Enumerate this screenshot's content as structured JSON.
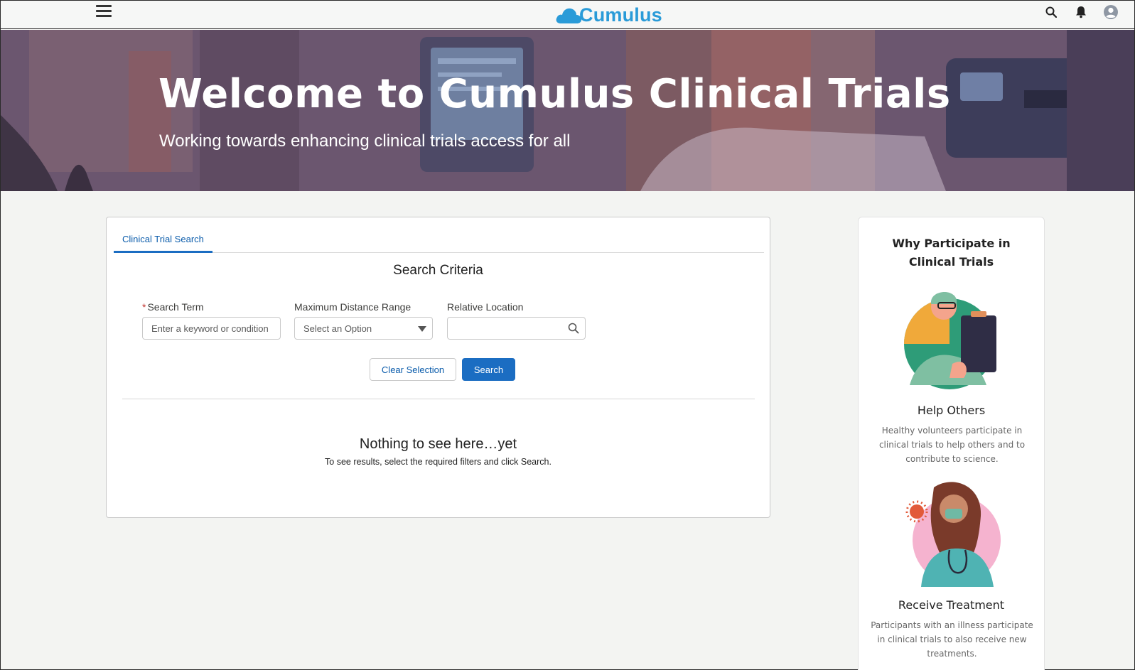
{
  "header": {
    "logo_text": "Cumulus",
    "brand_color": "#2a9bd8",
    "icons": [
      "menu-icon",
      "search-icon",
      "bell-icon",
      "user-avatar-icon"
    ]
  },
  "hero": {
    "title": "Welcome to Cumulus Clinical Trials",
    "subtitle": "Working towards enhancing clinical trials access for all"
  },
  "search_card": {
    "tab_label": "Clinical Trial Search",
    "section_title": "Search Criteria",
    "fields": {
      "search_term": {
        "label": "Search Term",
        "required_mark": "*",
        "placeholder": "Enter a keyword or condition"
      },
      "distance": {
        "label": "Maximum Distance Range",
        "value": "Select an Option"
      },
      "location": {
        "label": "Relative Location",
        "value": ""
      }
    },
    "clear_label": "Clear Selection",
    "search_label": "Search",
    "empty_title": "Nothing to see here…yet",
    "empty_subtitle": "To see results, select the required filters and click Search."
  },
  "sidebar": {
    "title_line1": "Why Participate in",
    "title_line2": "Clinical Trials",
    "items": [
      {
        "heading": "Help Others",
        "lines": [
          "Healthy volunteers participate in",
          "clinical trials to help others and to",
          "contribute to science."
        ]
      },
      {
        "heading": "Receive Treatment",
        "lines": [
          "Participants with an illness participate",
          "in clinical trials to also receive new",
          "treatments."
        ]
      }
    ]
  },
  "colors": {
    "accent": "#1b6dc2",
    "link": "#0b5cab",
    "required": "#c23934"
  }
}
